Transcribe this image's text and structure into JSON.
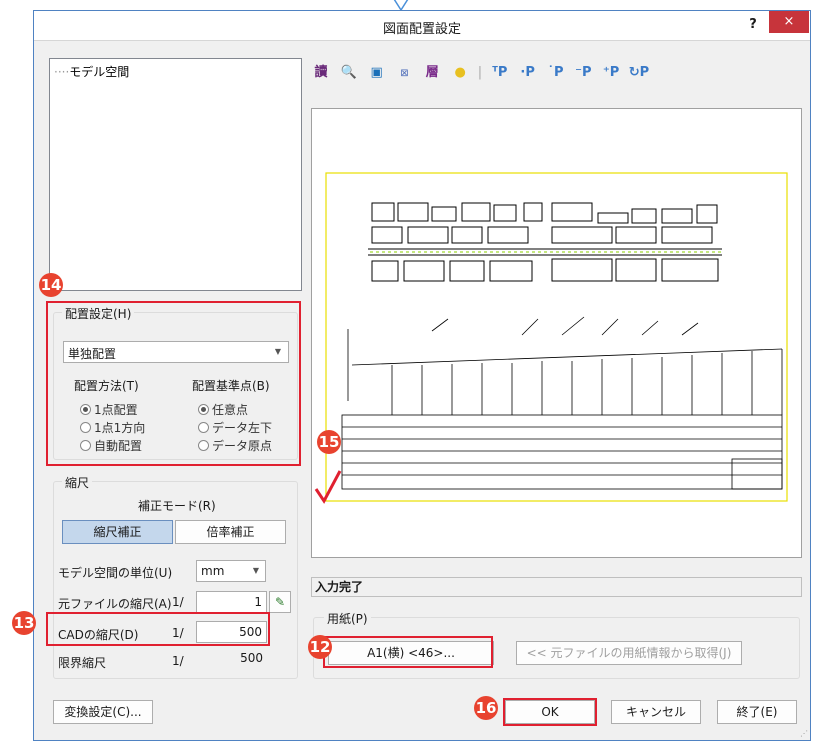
{
  "window": {
    "title": "図面配置設定",
    "help": "?",
    "close": "×"
  },
  "tree": {
    "items": [
      "モデル空間"
    ]
  },
  "layout_group": {
    "label": "配置設定(H)",
    "mode_value": "単独配置",
    "method_label": "配置方法(T)",
    "method_options": [
      "1点配置",
      "1点1方向",
      "自動配置"
    ],
    "method_selected": 0,
    "base_label": "配置基準点(B)",
    "base_options": [
      "任意点",
      "データ左下",
      "データ原点"
    ],
    "base_selected": 0
  },
  "scale_group": {
    "label": "縮尺",
    "mode_label": "補正モード(R)",
    "mode_buttons": [
      "縮尺補正",
      "倍率補正"
    ],
    "unit_label": "モデル空間の単位(U)",
    "unit_value": "mm",
    "source_scale_label": "元ファイルの縮尺(A)",
    "source_scale_prefix": "1/",
    "source_scale_value": "1",
    "cad_scale_label": "CADの縮尺(D)",
    "cad_scale_prefix": "1/",
    "cad_scale_value": "500",
    "limit_scale_label": "限界縮尺",
    "limit_scale_prefix": "1/",
    "limit_scale_value": "500"
  },
  "toolbar": {
    "icons": [
      "read-icon",
      "zoom-icon",
      "move-icon",
      "scale-icon",
      "layer-icon",
      "light-icon",
      "point-top-left-icon",
      "point-top-right-icon",
      "point-center-icon",
      "point-bottom-icon",
      "point-all-icon",
      "point-rotate-icon"
    ]
  },
  "status": {
    "text": "入力完了"
  },
  "paper_group": {
    "label": "用紙(P)",
    "paper_button": "A1(横) <46>...",
    "from_source_button": "<< 元ファイルの用紙情報から取得(J)"
  },
  "footer": {
    "convert_button": "変換設定(C)...",
    "ok": "OK",
    "cancel": "キャンセル",
    "exit": "終了(E)"
  },
  "badges": {
    "b12": "12",
    "b13": "13",
    "b14": "14",
    "b15": "15",
    "b16": "16"
  },
  "colors": {
    "accent_red": "#e02030",
    "badge": "#e8432f",
    "close": "#c7343b",
    "frame_yellow": "#e8e000"
  }
}
